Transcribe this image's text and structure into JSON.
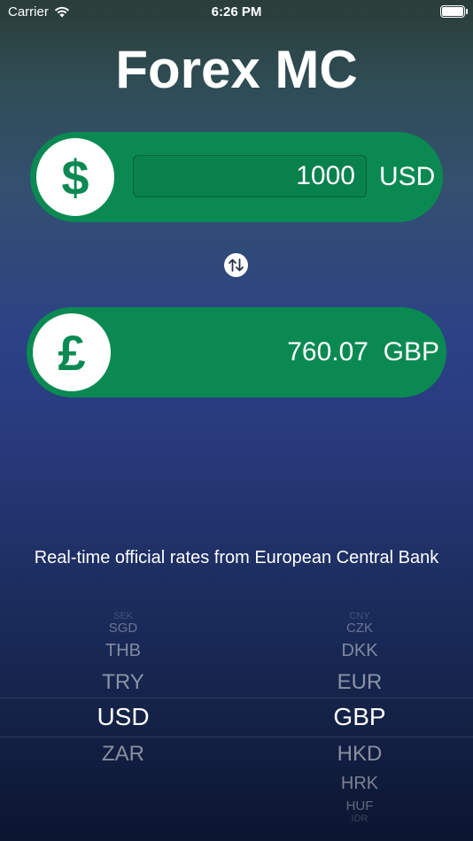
{
  "status": {
    "carrier": "Carrier",
    "time": "6:26 PM"
  },
  "app": {
    "title": "Forex MC"
  },
  "from": {
    "symbol": "$",
    "amount": "1000",
    "currency": "USD"
  },
  "to": {
    "symbol": "£",
    "amount": "760.07",
    "currency": "GBP"
  },
  "footer": {
    "source": "Real-time official rates from European Central Bank"
  },
  "picker_from": {
    "rows": [
      "SEK",
      "SGD",
      "THB",
      "TRY",
      "USD",
      "ZAR",
      "",
      "",
      ""
    ]
  },
  "picker_to": {
    "rows": [
      "CNY",
      "CZK",
      "DKK",
      "EUR",
      "GBP",
      "HKD",
      "HRK",
      "HUF",
      "IDR"
    ]
  },
  "colors": {
    "accent": "#0a8a52"
  }
}
